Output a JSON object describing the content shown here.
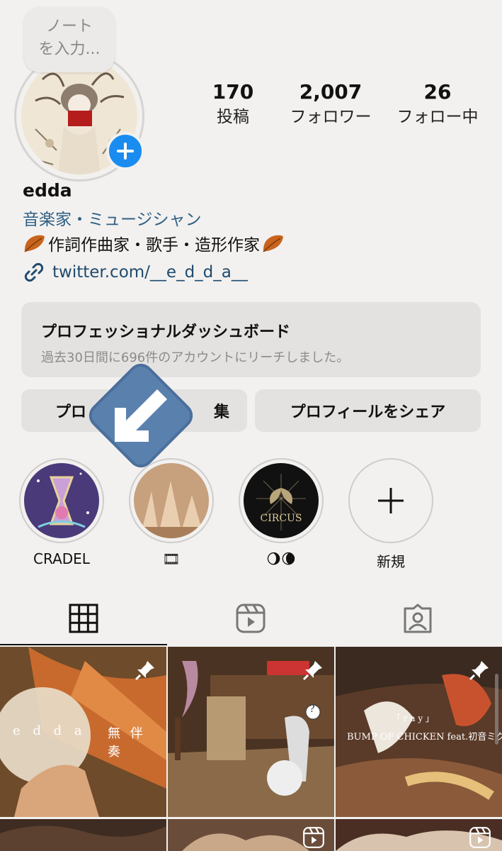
{
  "note": {
    "line1": "ノート",
    "line2": "を入力..."
  },
  "stats": [
    {
      "value": "170",
      "label": "投稿"
    },
    {
      "value": "2,007",
      "label": "フォロワー"
    },
    {
      "value": "26",
      "label": "フォロー中"
    }
  ],
  "profile": {
    "username": "edda",
    "category": "音楽家・ミュージシャン",
    "bio": "作詞作曲家・歌手・造形作家",
    "link": "twitter.com/__e_d_d_a__"
  },
  "dashboard": {
    "title": "プロフェッショナルダッシュボード",
    "subtitle": "過去30日間に696件のアカウントにリーチしました。"
  },
  "buttons": {
    "edit_visible": "プロ",
    "edit_suffix": "集",
    "share": "プロフィールをシェア"
  },
  "highlights": [
    {
      "label": "CRADEL"
    },
    {
      "label": "🎞"
    },
    {
      "label": "🌖🌘"
    },
    {
      "label": "新規"
    }
  ],
  "posts": [
    {
      "text_left": "e d d a",
      "text_right": "無 伴 奏"
    },
    {
      "text": "?"
    },
    {
      "text_top": "「 r a y 」",
      "text_main": "BUMP OF CHICKEN feat.初音ミク"
    }
  ],
  "colors": {
    "accent_blue": "#1a8cf0",
    "link": "#1f4a6e",
    "category": "#2f5f84",
    "background": "#f2f1ef",
    "button_bg": "#e4e2e0"
  },
  "icons": {
    "tab_grid": "grid-icon",
    "tab_reels": "reels-icon",
    "tab_tagged": "tagged-icon"
  }
}
